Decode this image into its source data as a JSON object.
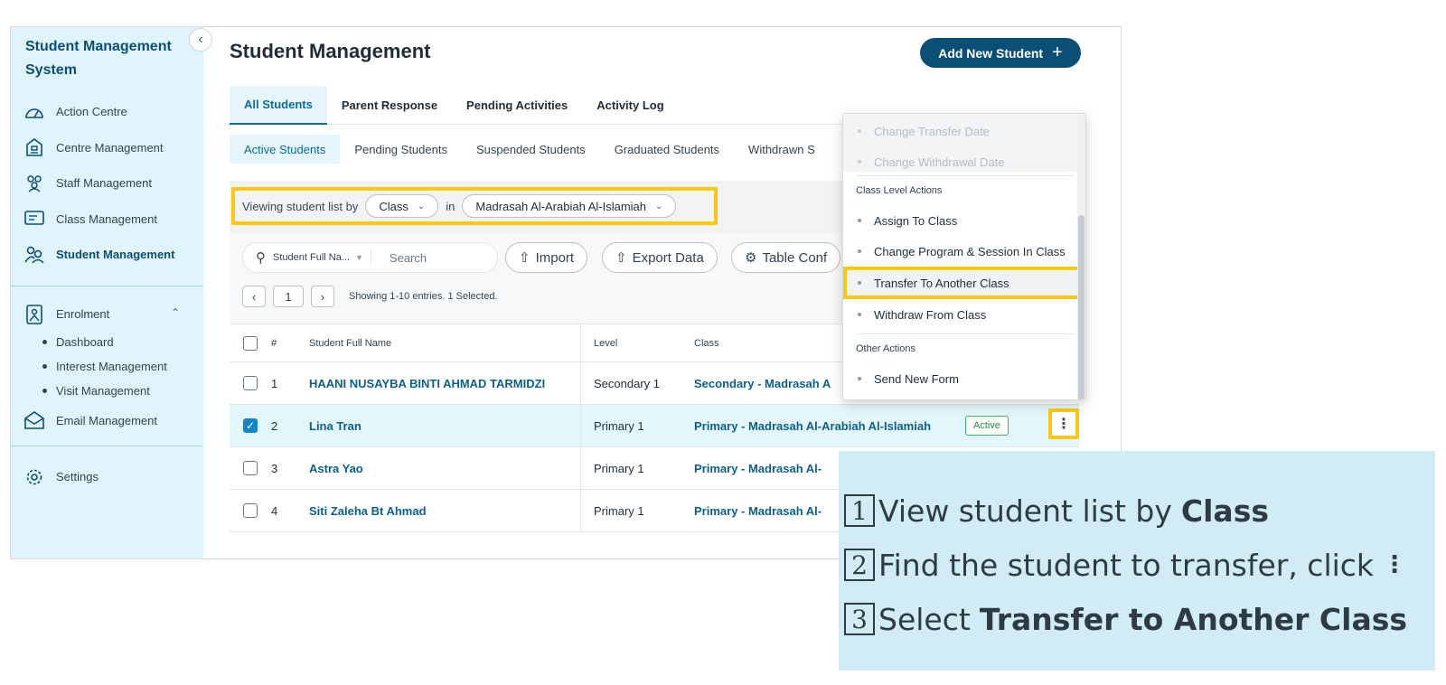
{
  "sidebar": {
    "brand": "Student Management System",
    "items": [
      {
        "label": "Action Centre"
      },
      {
        "label": "Centre Management"
      },
      {
        "label": "Staff Management"
      },
      {
        "label": "Class Management"
      },
      {
        "label": "Student Management"
      }
    ],
    "enrolment": {
      "label": "Enrolment",
      "subitems": [
        "Dashboard",
        "Interest Management",
        "Visit Management"
      ]
    },
    "email": "Email Management",
    "settings": "Settings"
  },
  "header": {
    "title": "Student Management",
    "add_button": "Add New Student"
  },
  "tabs": [
    "All Students",
    "Parent Response",
    "Pending Activities",
    "Activity Log"
  ],
  "subtabs": [
    "Active Students",
    "Pending Students",
    "Suspended Students",
    "Graduated Students",
    "Withdrawn S"
  ],
  "filter": {
    "prefix": "Viewing student list by",
    "by": "Class",
    "in": "in",
    "target": "Madrasah Al-Arabiah Al-Islamiah"
  },
  "toolbar": {
    "search_field": "Student Full Na...",
    "search_placeholder": "Search",
    "import": "Import",
    "export": "Export Data",
    "table_config": "Table Conf",
    "page": "1",
    "showing": "Showing 1-10 entries. 1 Selected."
  },
  "table": {
    "headers": {
      "num": "#",
      "name": "Student Full Name",
      "level": "Level",
      "class": "Class"
    },
    "rows": [
      {
        "num": "1",
        "name": "HAANI NUSAYBA BINTI AHMAD TARMIDZI",
        "level": "Secondary 1",
        "class": "Secondary - Madrasah A"
      },
      {
        "num": "2",
        "name": "Lina Tran",
        "level": "Primary 1",
        "class": "Primary - Madrasah Al-Arabiah Al-Islamiah",
        "status": "Active"
      },
      {
        "num": "3",
        "name": "Astra Yao",
        "level": "Primary 1",
        "class": "Primary - Madrasah Al-"
      },
      {
        "num": "4",
        "name": "Siti Zaleha Bt Ahmad",
        "level": "Primary 1",
        "class": "Primary - Madrasah Al-"
      }
    ]
  },
  "menu": {
    "disabled": [
      "Change Transfer Date",
      "Change Withdrawal Date"
    ],
    "class_heading": "Class Level Actions",
    "class_actions": [
      "Assign To Class",
      "Change Program & Session In Class",
      "Transfer To Another Class",
      "Withdraw From Class"
    ],
    "other_heading": "Other Actions",
    "other_actions": [
      "Send New Form"
    ]
  },
  "callout": {
    "step1_num": "1",
    "step1_text": "View student list by",
    "step1_bold": "Class",
    "step2_num": "2",
    "step2_text": "Find the student to transfer, click",
    "step3_num": "3",
    "step3_text": "Select",
    "step3_bold": "Transfer to Another Class"
  },
  "colors": {
    "brand": "#0b4f76",
    "highlight": "#f7c81a",
    "sidebar_bg": "#dff4fb",
    "callout_bg": "#d2ecf6",
    "active_green": "#1f8e3a"
  }
}
